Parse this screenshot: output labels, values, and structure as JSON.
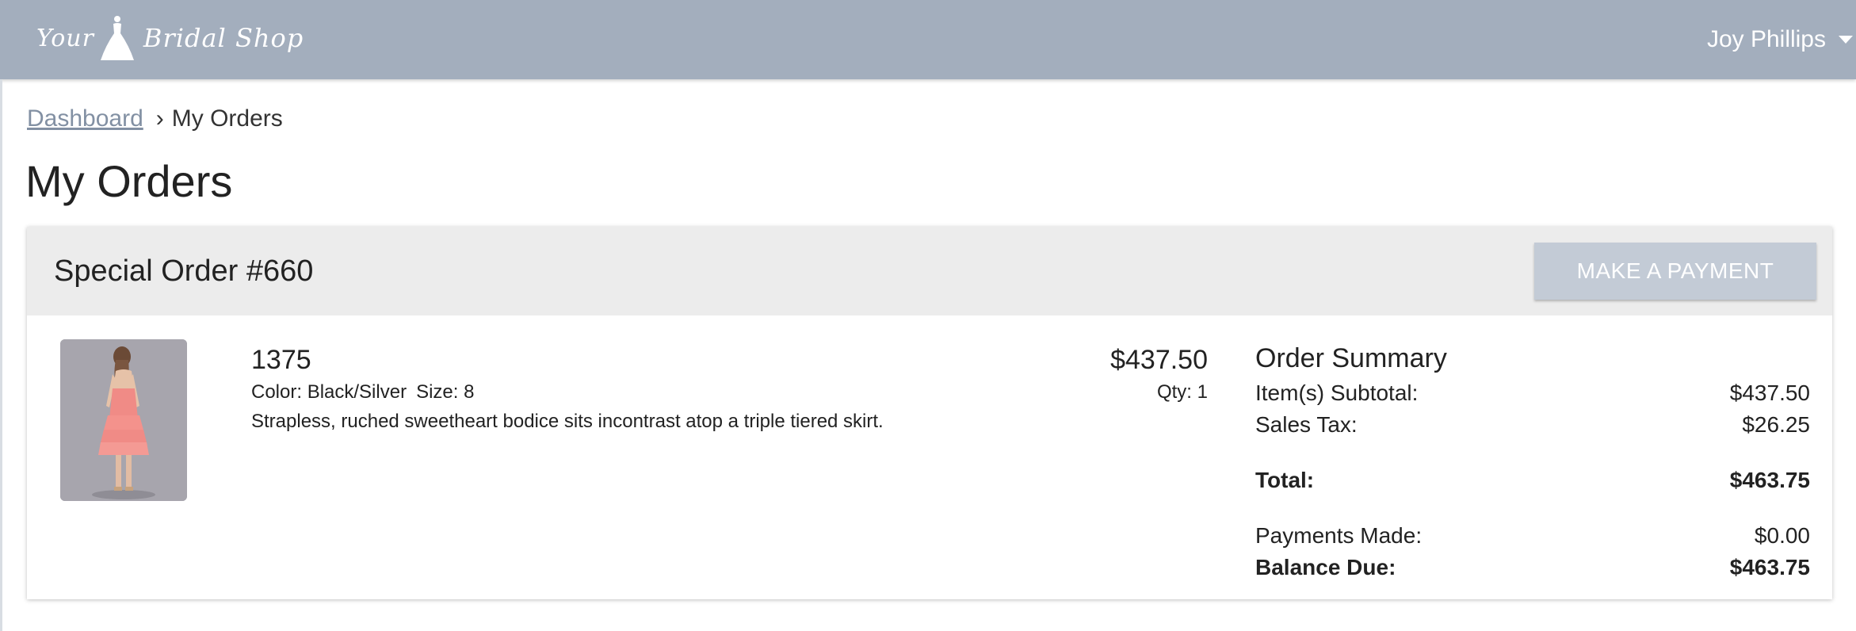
{
  "header": {
    "logo_word1": "Your",
    "logo_word2": "Bridal Shop",
    "user_name": "Joy Phillips"
  },
  "breadcrumb": {
    "link": "Dashboard",
    "separator": "›",
    "current": "My Orders"
  },
  "page": {
    "title": "My Orders"
  },
  "order": {
    "title": "Special Order #660",
    "pay_button": "MAKE A PAYMENT",
    "item": {
      "name": "1375",
      "color_text": "Color: Black/Silver",
      "size_text": "Size: 8",
      "description": "Strapless, ruched sweetheart bodice sits incontrast atop a triple tiered skirt.",
      "price": "$437.50",
      "qty_text": "Qty: 1"
    },
    "summary": {
      "title": "Order Summary",
      "subtotal_label": "Item(s) Subtotal:",
      "subtotal_value": "$437.50",
      "tax_label": "Sales Tax:",
      "tax_value": "$26.25",
      "total_label": "Total:",
      "total_value": "$463.75",
      "payments_label": "Payments Made:",
      "payments_value": "$0.00",
      "balance_label": "Balance Due:",
      "balance_value": "$463.75"
    }
  },
  "colors": {
    "header_bg": "#a3aebd",
    "button_bg": "#c3cbd6",
    "card_header_bg": "#ececec",
    "link": "#8290a3",
    "dress": "#f08b86"
  },
  "icons": [
    "dress-logo-icon",
    "caret-down-icon"
  ]
}
